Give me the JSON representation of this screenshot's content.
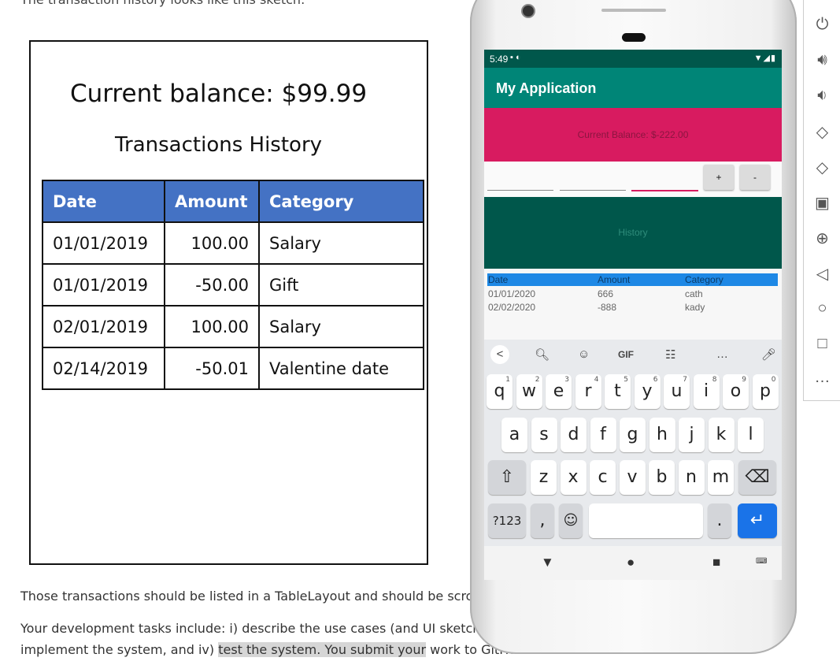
{
  "document": {
    "intro_text": "The transaction history looks like this sketch:",
    "sketch": {
      "balance_title": "Current balance: $99.99",
      "history_title": "Transactions History",
      "columns": [
        "Date",
        "Amount",
        "Category"
      ],
      "rows": [
        {
          "date": "01/01/2019",
          "amount": "100.00",
          "category": "Salary"
        },
        {
          "date": "01/01/2019",
          "amount": "-50.00",
          "category": "Gift"
        },
        {
          "date": "02/01/2019",
          "amount": "100.00",
          "category": "Salary"
        },
        {
          "date": "02/14/2019",
          "amount": "-50.01",
          "category": "Valentine date"
        }
      ],
      "header_color": "#4472c4"
    },
    "paragraph1": "Those transactions should be listed in a TableLayout and should be scrolla",
    "paragraph2": "Your development tasks include: i) describe the use cases (and UI sketches,",
    "paragraph3_pre": "implement the system, and iv) ",
    "paragraph3_highlight": "test the system. You submit your",
    "paragraph3_post": " work to GitHu"
  },
  "phone": {
    "status": {
      "time": "5:49",
      "left_icons": "▪ ◐",
      "right_icons": "▼◢▮"
    },
    "app_title": "My Application",
    "balance_text": "Current Balance: $-222.00",
    "plus_label": "+",
    "minus_label": "-",
    "history_label": "History",
    "table": {
      "columns": [
        "Date",
        "Amount",
        "Category"
      ],
      "rows": [
        {
          "date": "01/01/2020",
          "amount": "666",
          "category": "cath"
        },
        {
          "date": "02/02/2020",
          "amount": "-888",
          "category": "kady"
        }
      ]
    },
    "colors": {
      "status": "#00574b",
      "appbar": "#008577",
      "balance": "#d81b60",
      "history": "#00574b",
      "table_header": "#1e88e5"
    },
    "keyboard": {
      "toolbar": [
        "<",
        "search-icon",
        "sticker-icon",
        "GIF",
        "clipboard-icon",
        "more-icon",
        "mic-icon"
      ],
      "row1": [
        "q",
        "w",
        "e",
        "r",
        "t",
        "y",
        "u",
        "i",
        "o",
        "p"
      ],
      "row1_digits": [
        "1",
        "2",
        "3",
        "4",
        "5",
        "6",
        "7",
        "8",
        "9",
        "0"
      ],
      "row2": [
        "a",
        "s",
        "d",
        "f",
        "g",
        "h",
        "j",
        "k",
        "l"
      ],
      "row3": [
        "z",
        "x",
        "c",
        "v",
        "b",
        "n",
        "m"
      ],
      "symbols_label": "?123",
      "comma": ",",
      "period": "."
    }
  },
  "emulator_toolbar": [
    "power-icon",
    "volume-up-icon",
    "volume-down-icon",
    "rotate-left-icon",
    "rotate-right-icon",
    "camera-icon",
    "zoom-icon",
    "back-icon",
    "home-icon",
    "overview-icon",
    "more-icon"
  ]
}
